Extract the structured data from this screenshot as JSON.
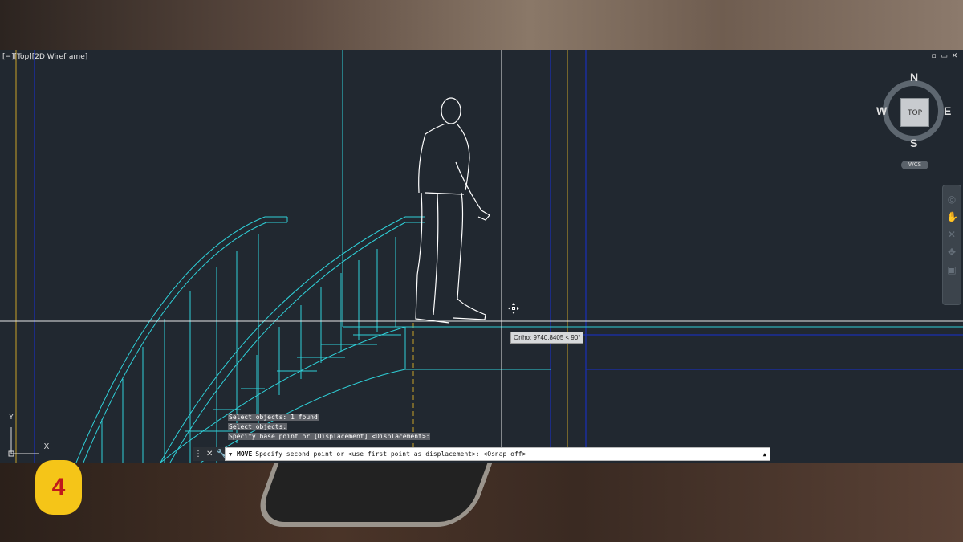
{
  "viewport": {
    "label": "[−][Top][2D Wireframe]",
    "window_controls": [
      "▫",
      "▭",
      "✕"
    ]
  },
  "viewcube": {
    "north": "N",
    "south": "S",
    "east": "E",
    "west": "W",
    "face": "TOP",
    "wcs": "WCS"
  },
  "tooltip": "Ortho: 9740.8405 < 90°",
  "command_history": [
    "Select objects: 1 found",
    "Select objects:",
    "Specify base point or [Displacement] <Displacement>:"
  ],
  "command_line": {
    "command": "MOVE",
    "prompt": "Specify second point or <use first point as displacement>:  <Osnap off>"
  },
  "ucs": {
    "x": "X",
    "y": "Y"
  },
  "step_badge": "4",
  "colors": {
    "viewport_bg": "#212830",
    "cyan_lines": "#2fd0d8",
    "blue_lines": "#1a2fb0",
    "yellow_lines": "#c9a227",
    "figure": "#ffffff",
    "badge": "#f5c518"
  }
}
